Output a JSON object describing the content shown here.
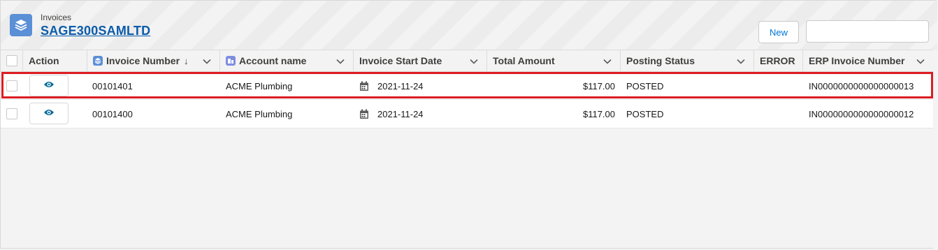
{
  "header": {
    "object_label": "Invoices",
    "record_title": "SAGE300SAMLTD",
    "new_button": "New",
    "search_value": "",
    "app_icon": "stacked-layers-icon"
  },
  "table": {
    "columns": [
      {
        "key": "action",
        "label": "Action"
      },
      {
        "key": "invoice_number",
        "label": "Invoice Number",
        "sort": "↓",
        "icon": "stacked-layers-icon"
      },
      {
        "key": "account_name",
        "label": "Account name",
        "icon": "account-icon"
      },
      {
        "key": "invoice_start_date",
        "label": "Invoice Start Date"
      },
      {
        "key": "total_amount",
        "label": "Total Amount"
      },
      {
        "key": "posting_status",
        "label": "Posting Status"
      },
      {
        "key": "error",
        "label": "ERROR"
      },
      {
        "key": "erp_invoice_number",
        "label": "ERP Invoice Number"
      }
    ],
    "rows": [
      {
        "invoice_number": "00101401",
        "account_name": "ACME Plumbing",
        "invoice_start_date": "2021-11-24",
        "total_amount": "$117.00",
        "posting_status": "POSTED",
        "error": "",
        "erp_invoice_number": "IN0000000000000000013",
        "highlighted": true
      },
      {
        "invoice_number": "00101400",
        "account_name": "ACME Plumbing",
        "invoice_start_date": "2021-11-24",
        "total_amount": "$117.00",
        "posting_status": "POSTED",
        "error": "",
        "erp_invoice_number": "IN0000000000000000012",
        "highlighted": false
      }
    ]
  },
  "colors": {
    "brand_blue": "#0b5cab",
    "app_icon_bg": "#5b8fd6",
    "account_icon_bg": "#7f8de1",
    "highlight_red": "#dd1c22",
    "eye_icon": "#0b6d99"
  }
}
